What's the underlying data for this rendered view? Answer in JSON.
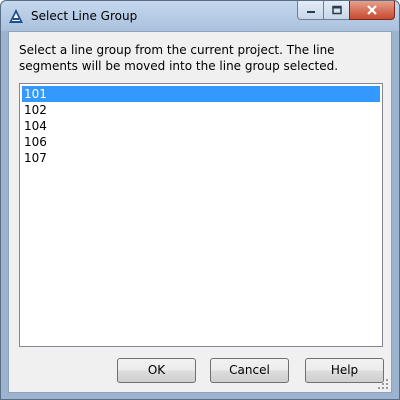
{
  "window": {
    "title": "Select Line Group",
    "app_icon": "autocad-civil-a-icon"
  },
  "instruction": "Select a line group from the current project. The line segments will be moved into the line group selected.",
  "list": {
    "items": [
      "101",
      "102",
      "104",
      "106",
      "107"
    ],
    "selected_index": 0
  },
  "buttons": {
    "ok": "OK",
    "cancel": "Cancel",
    "help": "Help"
  },
  "colors": {
    "selection": "#3399ff",
    "close_button": "#c8492e"
  }
}
